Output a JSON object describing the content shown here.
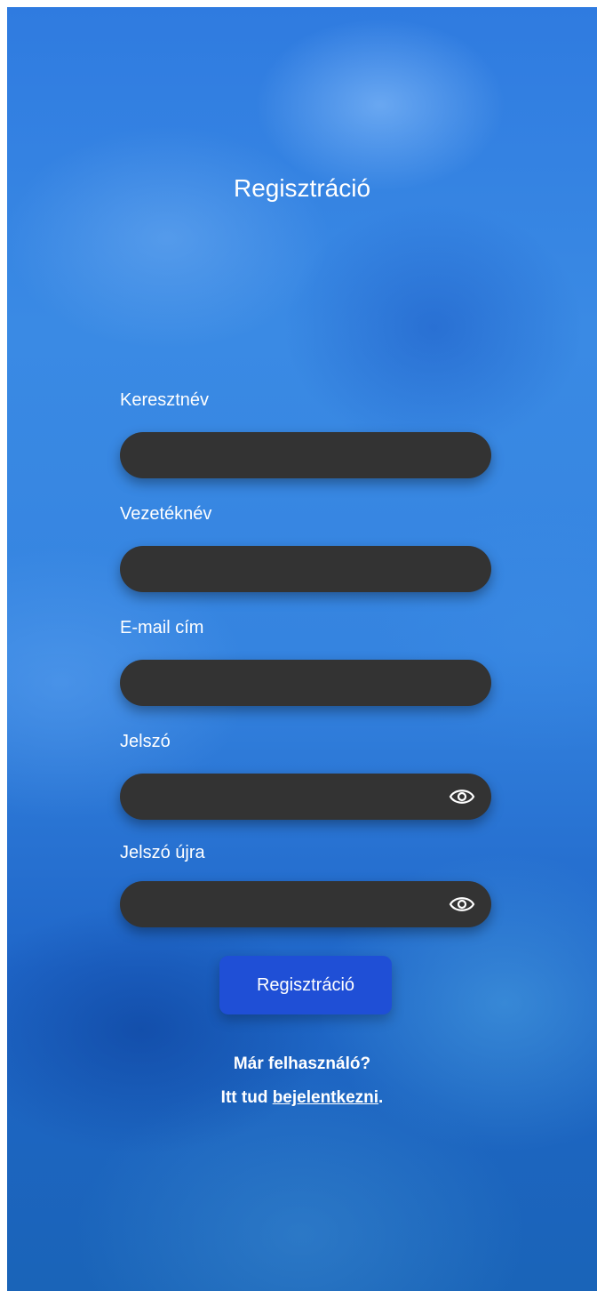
{
  "page": {
    "title": "Regisztráció"
  },
  "form": {
    "fields": [
      {
        "label": "Keresztnév",
        "value": ""
      },
      {
        "label": "Vezetéknév",
        "value": ""
      },
      {
        "label": "E-mail cím",
        "value": ""
      },
      {
        "label": "Jelszó",
        "value": ""
      },
      {
        "label": "Jelszó újra",
        "value": ""
      }
    ],
    "submit_label": "Regisztráció"
  },
  "footer": {
    "line1": "Már felhasználó?",
    "line2_prefix": "Itt tud ",
    "login_link": "bejelentkezni",
    "line2_suffix": "."
  },
  "icons": {
    "password_toggle": "eye-icon"
  },
  "colors": {
    "field_background": "#333333",
    "button_background": "#1f4fd6",
    "text": "#ffffff"
  }
}
